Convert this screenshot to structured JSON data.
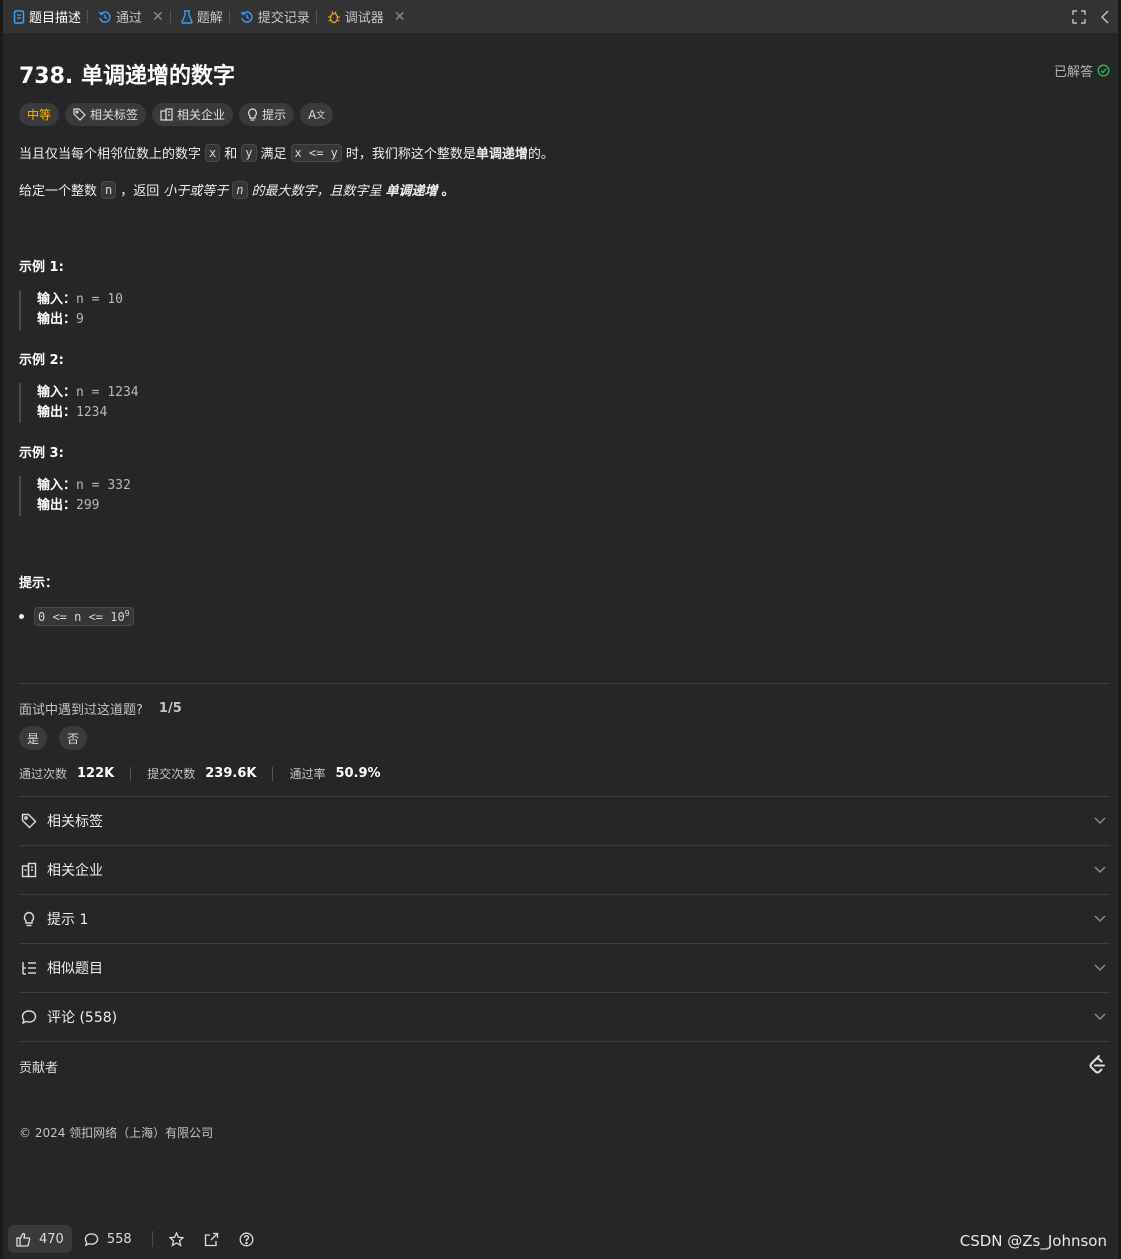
{
  "tabs": [
    {
      "label": "题目描述",
      "icon": "description-icon",
      "closable": false,
      "active": true
    },
    {
      "label": "通过",
      "icon": "history-icon",
      "closable": true,
      "active": false
    },
    {
      "label": "题解",
      "icon": "flask-icon",
      "closable": false,
      "active": false
    },
    {
      "label": "提交记录",
      "icon": "history-icon",
      "closable": false,
      "active": false
    },
    {
      "label": "调试器",
      "icon": "bug-icon",
      "closable": true,
      "active": false
    }
  ],
  "problem": {
    "title": "738. 单调递增的数字",
    "solved_label": "已解答",
    "difficulty": "中等",
    "chips": [
      "相关标签",
      "相关企业",
      "提示"
    ],
    "desc1": {
      "p1": "当且仅当每个相邻位数上的数字",
      "c1": "x",
      "p2": "和",
      "c2": "y",
      "p3": "满足",
      "c3": "x <= y",
      "p4": "时，我们称这个整数是",
      "b1": "单调递增",
      "p5": "的。"
    },
    "desc2": {
      "p1": "给定一个整数",
      "c1": "n",
      "p2": "，返回",
      "i1": "小于或等于",
      "c2": "n",
      "i2": "的最大数字，且数字呈",
      "b1": "单调递增",
      "p3": "。"
    },
    "examples": [
      {
        "heading": "示例 1:",
        "input_label": "输入：",
        "input": "n = 10",
        "output_label": "输出：",
        "output": "9"
      },
      {
        "heading": "示例 2:",
        "input_label": "输入：",
        "input": "n = 1234",
        "output_label": "输出：",
        "output": "1234"
      },
      {
        "heading": "示例 3:",
        "input_label": "输入：",
        "input": "n = 332",
        "output_label": "输出：",
        "output": "299"
      }
    ],
    "hint_heading": "提示：",
    "constraint_base": "0 <= n <= 10",
    "constraint_exp": "9"
  },
  "interview": {
    "question": "面试中遇到过这道题?",
    "count": "1/5",
    "yes": "是",
    "no": "否"
  },
  "stats": {
    "accepted_label": "通过次数",
    "accepted": "122K",
    "submissions_label": "提交次数",
    "submissions": "239.6K",
    "rate_label": "通过率",
    "rate": "50.9%"
  },
  "sections": [
    {
      "label": "相关标签",
      "icon": "tag-icon"
    },
    {
      "label": "相关企业",
      "icon": "building-icon"
    },
    {
      "label": "提示 1",
      "icon": "lightbulb-icon"
    },
    {
      "label": "相似题目",
      "icon": "list-tree-icon"
    },
    {
      "label": "评论 (558)",
      "icon": "comment-icon"
    }
  ],
  "contributors_label": "贡献者",
  "copyright": "© 2024 领扣网络（上海）有限公司",
  "bottom": {
    "likes": "470",
    "comments": "558"
  },
  "watermark": "CSDN @Zs_Johnson",
  "colors": {
    "medium": "#ffb800",
    "solved_check": "#2cbb5d",
    "background": "#262626"
  }
}
